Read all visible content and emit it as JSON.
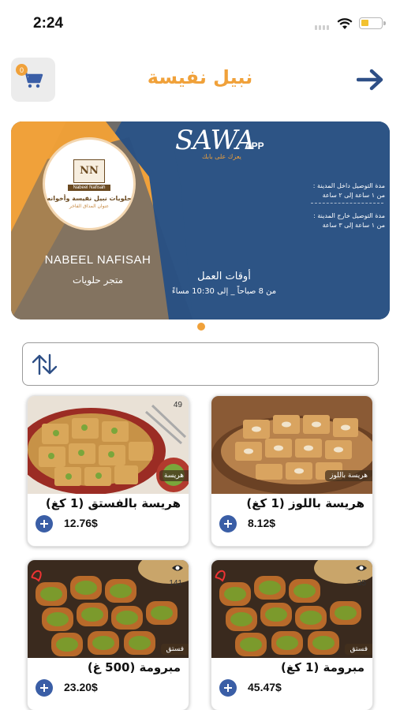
{
  "status_bar": {
    "time": "2:24"
  },
  "header": {
    "title": "نبيل نفيسة",
    "cart_count": "0"
  },
  "banner": {
    "app_logo": "SAWA",
    "app_suffix": "APP",
    "app_tagline": "يعزك على بابك",
    "store_name_en": "NABEEL NAFISAH",
    "store_type": "متجر حلويات",
    "logo_mark": "NN",
    "logo_ribbon": "Nabeel Nafisah",
    "logo_line1": "حلويات نبيل نفيسة وأخوانه",
    "logo_line2": "عنوان المذاق الفاخر",
    "hours_title": "أوقات العمل",
    "hours_range": "من 8 صباحاً _ إلى 10:30 مساءً",
    "delivery_inside_title": "مدة التوصيل داخل المدينة :",
    "delivery_inside_value": "من ١ ساعة إلى ٢ ساعة",
    "delivery_outside_title": "مدة التوصيل خارج المدينة :",
    "delivery_outside_value": "من ١ ساعة إلى ٣ ساعة"
  },
  "products": [
    {
      "name": "هريسة بالفستق (1 كغ)",
      "price": "12.76$",
      "views": "49",
      "tag": "هريسة"
    },
    {
      "name": "هريسة باللوز (1 كغ)",
      "price": "8.12$",
      "views": "",
      "tag": "هريسة باللوز"
    },
    {
      "name": "مبرومة (500 غ)",
      "price": "23.20$",
      "views": "141",
      "tag": "فستق"
    },
    {
      "name": "مبرومة (1 كغ)",
      "price": "45.47$",
      "views": "35",
      "tag": "فستق"
    }
  ],
  "colors": {
    "accent": "#f0a13a",
    "banner_blue": "#2d5485",
    "add_button": "#3a5ea6",
    "back_arrow": "#2e4f86"
  }
}
